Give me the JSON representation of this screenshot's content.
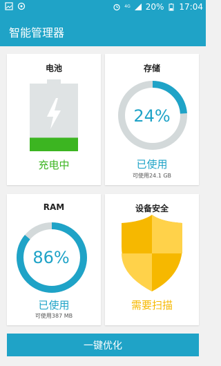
{
  "statusbar": {
    "battery_percent": "20%",
    "time": "17:04",
    "network": "4G"
  },
  "app": {
    "title": "智能管理器"
  },
  "battery": {
    "heading": "电池",
    "status": "充电中",
    "level": 0.2
  },
  "storage": {
    "heading": "存储",
    "percent_text": "24%",
    "used_fraction": 0.24,
    "status": "已使用",
    "available": "可使用24.1 GB"
  },
  "ram": {
    "heading": "RAM",
    "percent_text": "86%",
    "used_fraction": 0.86,
    "status": "已使用",
    "available": "可使用387 MB"
  },
  "security": {
    "heading": "设备安全",
    "status": "需要扫描"
  },
  "bottom_button": {
    "label": "一键优化"
  },
  "colors": {
    "accent": "#1fa3c7",
    "green": "#3cb521",
    "yellow": "#f6b800",
    "track": "#d3d9da"
  }
}
